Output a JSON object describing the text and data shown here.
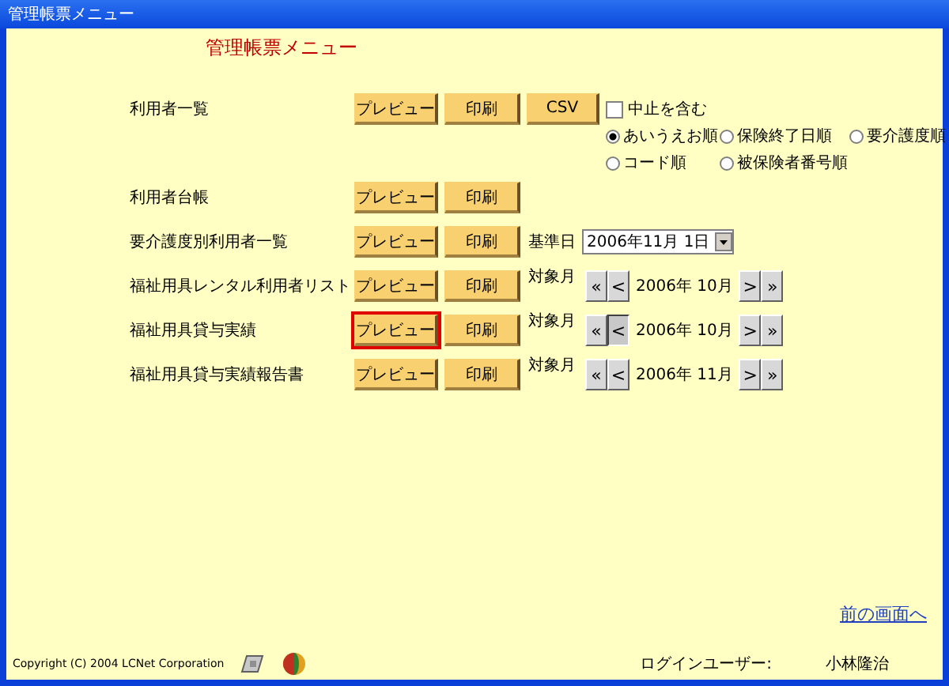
{
  "window": {
    "title": "管理帳票メニュー"
  },
  "heading": "管理帳票メニュー",
  "reports": [
    {
      "label": "利用者一覧",
      "kind": "csv",
      "buttons": [
        {
          "label": "プレビュー",
          "focused": false
        },
        {
          "label": "印刷",
          "focused": false
        },
        {
          "label": "CSV",
          "focused": false
        }
      ],
      "option": {
        "label": "中止を含む",
        "checked": false
      }
    },
    {
      "label": "利用者台帳",
      "kind": "basic",
      "buttons": [
        {
          "label": "プレビュー",
          "focused": false
        },
        {
          "label": "印刷",
          "focused": false
        }
      ]
    },
    {
      "label": "要介護度別利用者一覧",
      "kind": "date",
      "buttons": [
        {
          "label": "プレビュー",
          "focused": false
        },
        {
          "label": "印刷",
          "focused": false
        }
      ],
      "field_label": "基準日",
      "value": "2006年11月 1日"
    },
    {
      "label": "福祉用具レンタル利用者リスト",
      "kind": "month",
      "buttons": [
        {
          "label": "プレビュー",
          "focused": false
        },
        {
          "label": "印刷",
          "focused": false
        }
      ],
      "field_label": "対象月",
      "value": "2006年 10月",
      "nav": [
        {
          "label": "«",
          "pressed": false
        },
        {
          "label": "<",
          "pressed": false
        },
        {
          "label": ">",
          "pressed": false
        },
        {
          "label": "»",
          "pressed": false
        }
      ]
    },
    {
      "label": "福祉用具貸与実績",
      "kind": "month",
      "buttons": [
        {
          "label": "プレビュー",
          "focused": true
        },
        {
          "label": "印刷",
          "focused": false
        }
      ],
      "field_label": "対象月",
      "value": "2006年 10月",
      "nav": [
        {
          "label": "«",
          "pressed": false
        },
        {
          "label": "<",
          "pressed": true
        },
        {
          "label": ">",
          "pressed": false
        },
        {
          "label": "»",
          "pressed": false
        }
      ]
    },
    {
      "label": "福祉用具貸与実績報告書",
      "kind": "month",
      "buttons": [
        {
          "label": "プレビュー",
          "focused": false
        },
        {
          "label": "印刷",
          "focused": false
        }
      ],
      "field_label": "対象月",
      "value": "2006年 11月",
      "nav": [
        {
          "label": "«",
          "pressed": false
        },
        {
          "label": "<",
          "pressed": false
        },
        {
          "label": ">",
          "pressed": false
        },
        {
          "label": "»",
          "pressed": false
        }
      ]
    }
  ],
  "sort_options": [
    {
      "label": "あいうえお順",
      "selected": true
    },
    {
      "label": "保険終了日順",
      "selected": false
    },
    {
      "label": "要介護度順",
      "selected": false
    },
    {
      "label": "コード順",
      "selected": false
    },
    {
      "label": "被保険者番号順",
      "selected": false
    }
  ],
  "footer": {
    "copyright": "Copyright (C) 2004 LCNet Corporation",
    "back_link": "前の画面へ",
    "login_label": "ログインユーザー:",
    "user": "小林隆治"
  }
}
